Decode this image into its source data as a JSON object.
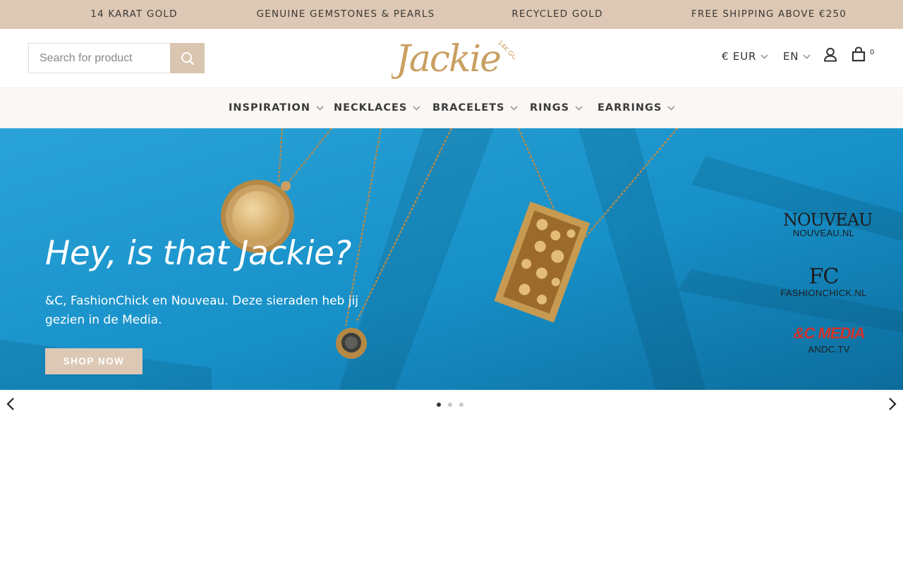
{
  "announcement": {
    "items": [
      "14 KARAT GOLD",
      "GENUINE GEMSTONES & PEARLS",
      "RECYCLED GOLD",
      "FREE SHIPPING ABOVE €250"
    ]
  },
  "header": {
    "search_placeholder": "Search for product",
    "logo_text": "Jackie",
    "logo_badge": "14K GOLD",
    "currency": "€ EUR",
    "language": "EN",
    "cart_count": "0"
  },
  "nav": {
    "items": [
      "INSPIRATION",
      "NECKLACES",
      "BRACELETS",
      "RINGS",
      "EARRINGS"
    ]
  },
  "hero": {
    "title": "Hey, is that Jackie?",
    "text": "&C, FashionChick en Nouveau. Deze sieraden heb jij gezien in de Media.",
    "cta": "SHOP NOW",
    "media": [
      {
        "logo": "NOUVEAU",
        "url": "NOUVEAU.NL"
      },
      {
        "logo": "FC",
        "url": "FASHIONCHICK.NL"
      },
      {
        "logo": "&C MEDIA",
        "url": "ANDC.TV"
      }
    ]
  },
  "slider": {
    "slide_count": 3,
    "active_index": 0
  },
  "colors": {
    "accent": "#dcc8b4",
    "hero_bg": "#1a8fc7",
    "gold": "#c9a062"
  }
}
